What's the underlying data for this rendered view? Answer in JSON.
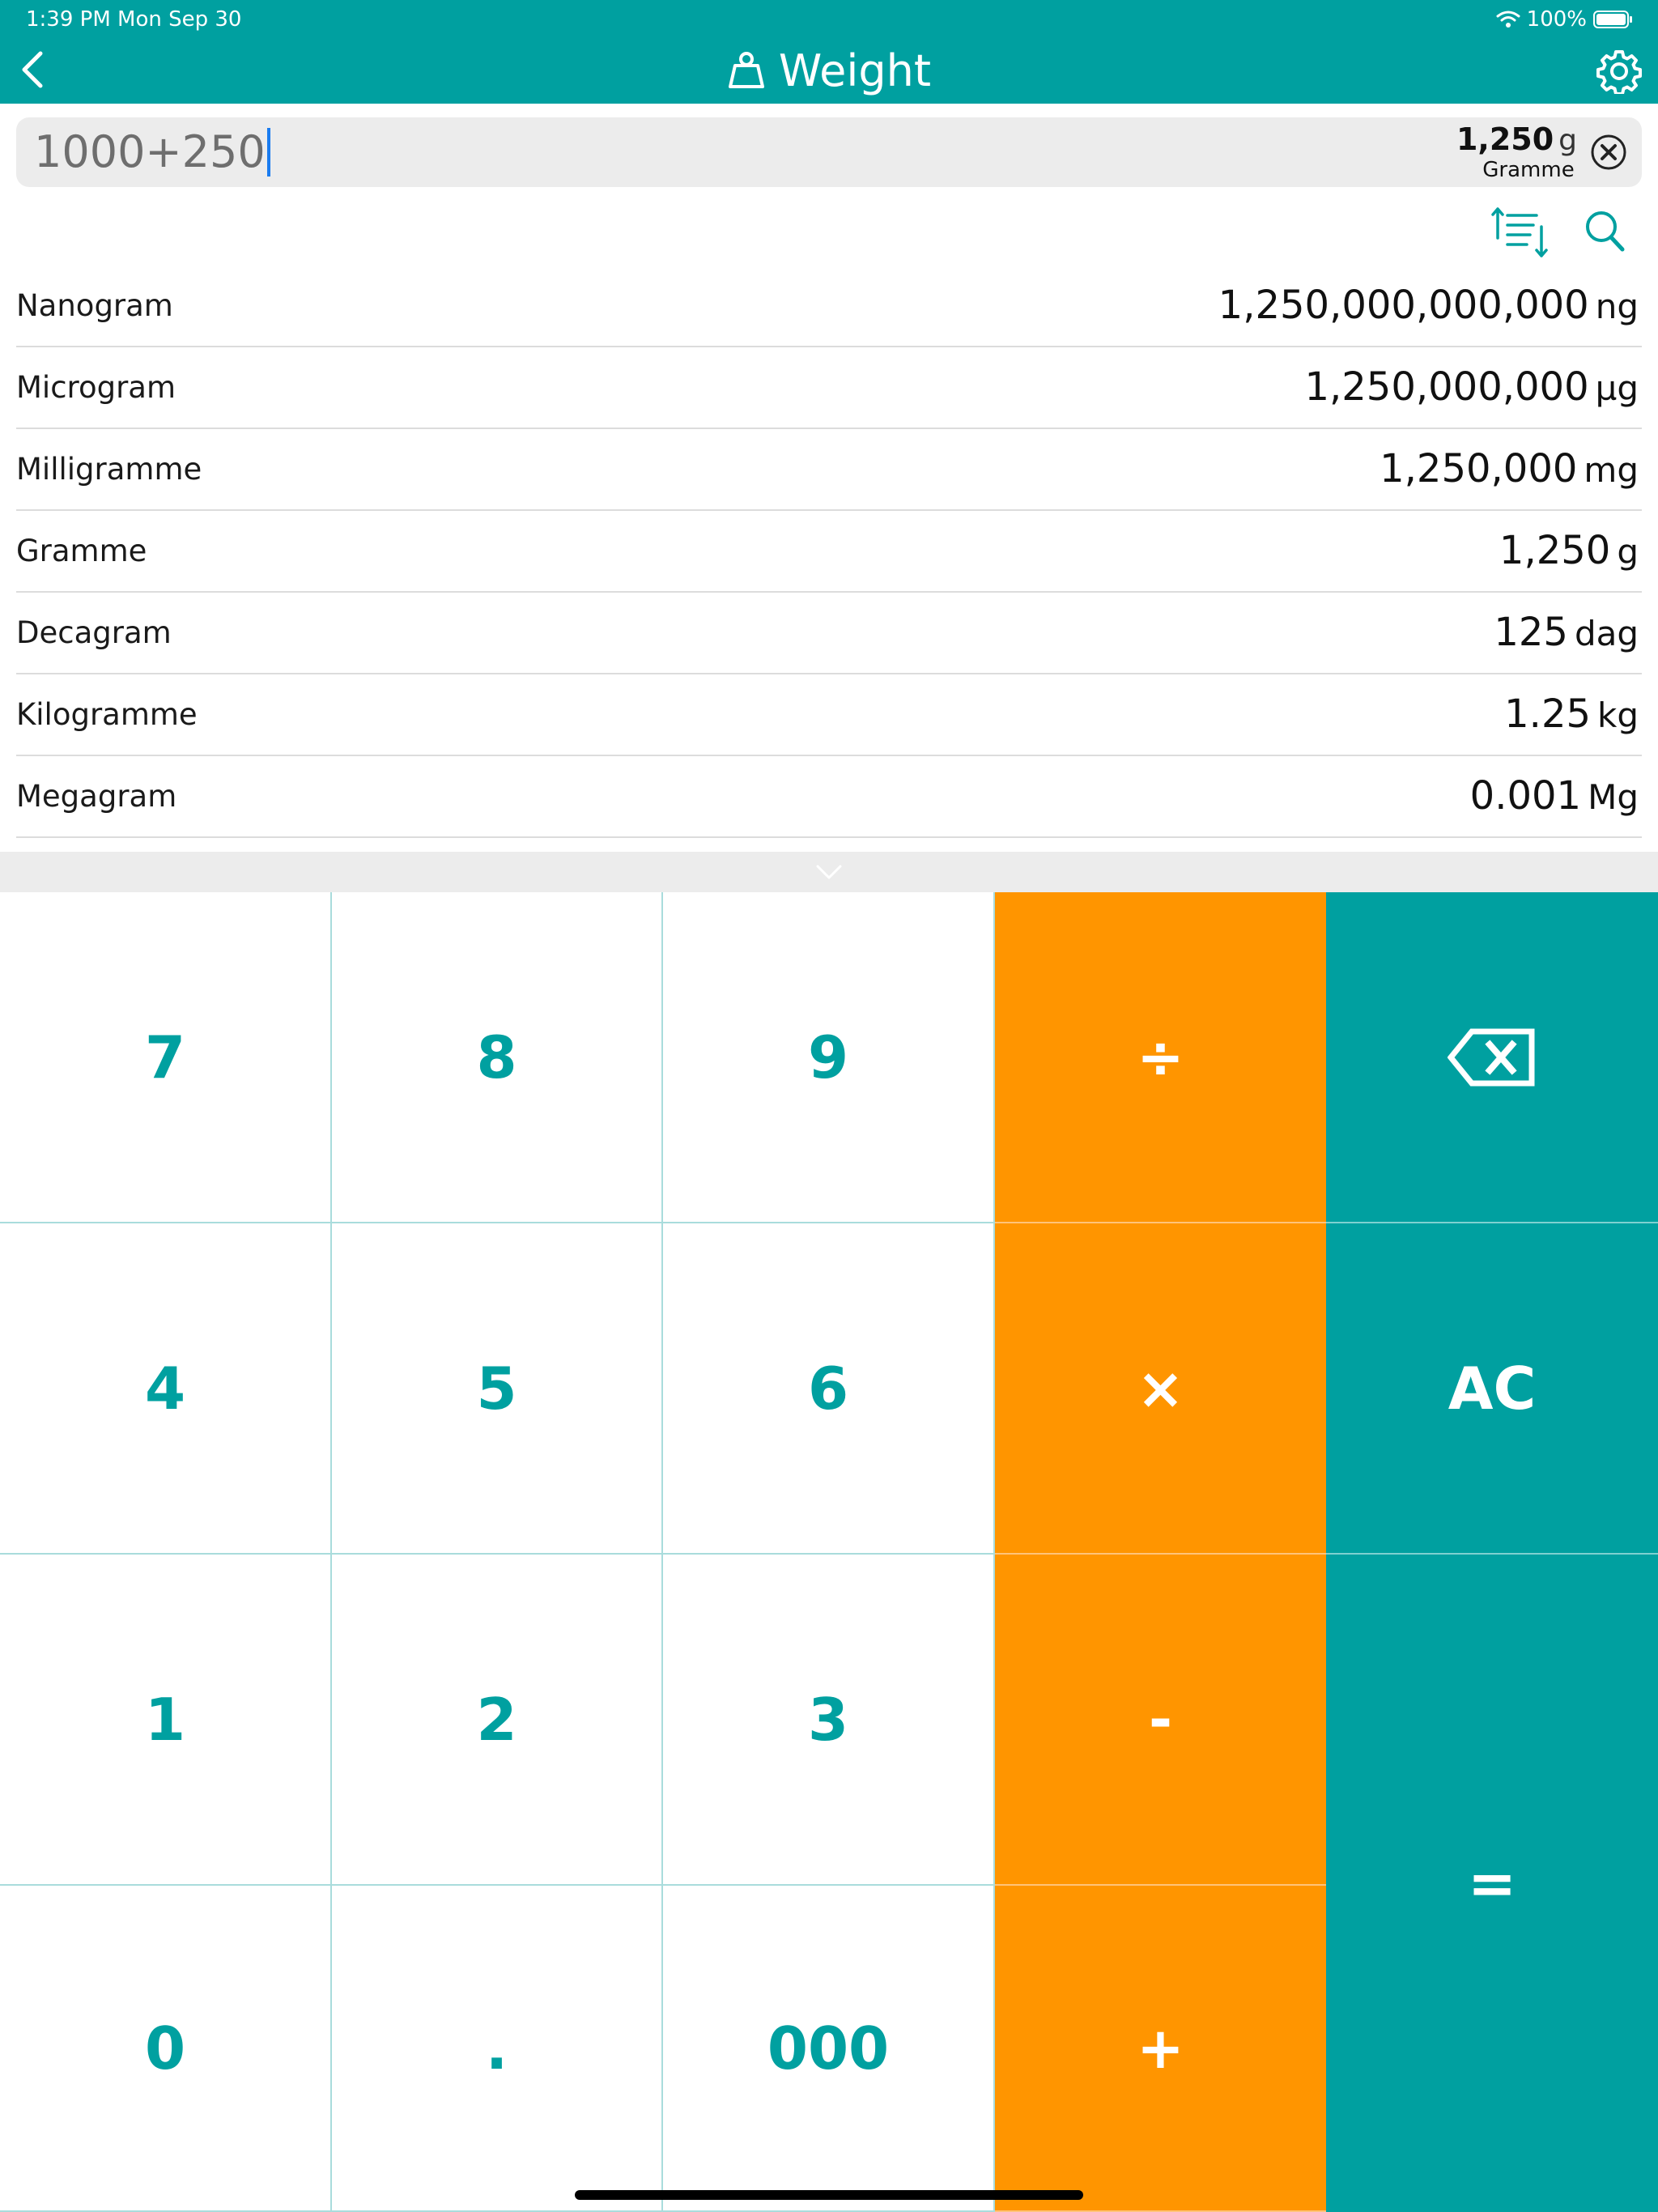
{
  "status_bar": {
    "time": "1:39 PM   Mon Sep 30",
    "battery": "100%"
  },
  "nav": {
    "title": "Weight",
    "icons": {
      "back": "chevron-left-icon",
      "title": "weight-icon",
      "settings": "gear-icon"
    }
  },
  "input": {
    "expression": "1000+250",
    "result_value": "1,250",
    "result_unit": "g",
    "result_unit_name": "Gramme"
  },
  "tools": {
    "sort_icon": "sort-icon",
    "search_icon": "search-icon"
  },
  "units": [
    {
      "name": "Nanogram",
      "value": "1,250,000,000,000",
      "symbol": "ng"
    },
    {
      "name": "Microgram",
      "value": "1,250,000,000",
      "symbol": "µg"
    },
    {
      "name": "Milligramme",
      "value": "1,250,000",
      "symbol": "mg"
    },
    {
      "name": "Gramme",
      "value": "1,250",
      "symbol": "g"
    },
    {
      "name": "Decagram",
      "value": "125",
      "symbol": "dag"
    },
    {
      "name": "Kilogramme",
      "value": "1.25",
      "symbol": "kg"
    },
    {
      "name": "Megagram",
      "value": "0.001",
      "symbol": "Mg"
    }
  ],
  "keypad": {
    "k7": "7",
    "k8": "8",
    "k9": "9",
    "divide": "÷",
    "k4": "4",
    "k5": "5",
    "k6": "6",
    "multiply": "×",
    "ac": "AC",
    "k1": "1",
    "k2": "2",
    "k3": "3",
    "minus": "-",
    "k0": "0",
    "dot": ".",
    "k000": "000",
    "plus": "+",
    "equals": "=",
    "backspace_icon": "backspace-icon"
  },
  "colors": {
    "teal": "#00A0A0",
    "orange": "#FF9500",
    "input_bg": "#ECECEC",
    "caret": "#1A7CF0"
  }
}
